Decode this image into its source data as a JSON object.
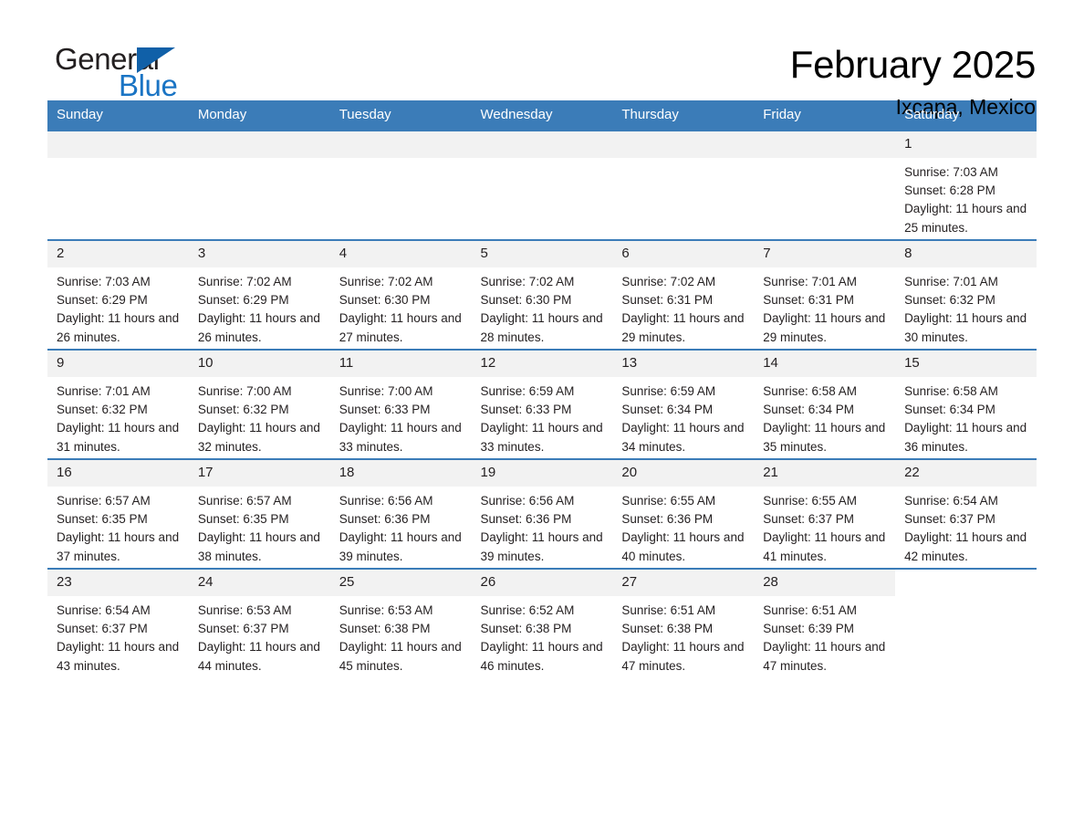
{
  "brand": {
    "name_top": "General",
    "name_bottom": "Blue",
    "accent_color": "#1a74c4",
    "triangle_color": "#1060a8"
  },
  "header": {
    "title": "February 2025",
    "subtitle": "Ixcapa, Mexico"
  },
  "calendar": {
    "header_bg": "#3b7cb8",
    "daynum_bg": "#f2f2f2",
    "weekday_headers": [
      "Sunday",
      "Monday",
      "Tuesday",
      "Wednesday",
      "Thursday",
      "Friday",
      "Saturday"
    ],
    "weeks": [
      [
        {
          "day": "",
          "empty": true
        },
        {
          "day": "",
          "empty": true
        },
        {
          "day": "",
          "empty": true
        },
        {
          "day": "",
          "empty": true
        },
        {
          "day": "",
          "empty": true
        },
        {
          "day": "",
          "empty": true
        },
        {
          "day": "1",
          "sunrise": "Sunrise: 7:03 AM",
          "sunset": "Sunset: 6:28 PM",
          "daylight": "Daylight: 11 hours and 25 minutes."
        }
      ],
      [
        {
          "day": "2",
          "sunrise": "Sunrise: 7:03 AM",
          "sunset": "Sunset: 6:29 PM",
          "daylight": "Daylight: 11 hours and 26 minutes."
        },
        {
          "day": "3",
          "sunrise": "Sunrise: 7:02 AM",
          "sunset": "Sunset: 6:29 PM",
          "daylight": "Daylight: 11 hours and 26 minutes."
        },
        {
          "day": "4",
          "sunrise": "Sunrise: 7:02 AM",
          "sunset": "Sunset: 6:30 PM",
          "daylight": "Daylight: 11 hours and 27 minutes."
        },
        {
          "day": "5",
          "sunrise": "Sunrise: 7:02 AM",
          "sunset": "Sunset: 6:30 PM",
          "daylight": "Daylight: 11 hours and 28 minutes."
        },
        {
          "day": "6",
          "sunrise": "Sunrise: 7:02 AM",
          "sunset": "Sunset: 6:31 PM",
          "daylight": "Daylight: 11 hours and 29 minutes."
        },
        {
          "day": "7",
          "sunrise": "Sunrise: 7:01 AM",
          "sunset": "Sunset: 6:31 PM",
          "daylight": "Daylight: 11 hours and 29 minutes."
        },
        {
          "day": "8",
          "sunrise": "Sunrise: 7:01 AM",
          "sunset": "Sunset: 6:32 PM",
          "daylight": "Daylight: 11 hours and 30 minutes."
        }
      ],
      [
        {
          "day": "9",
          "sunrise": "Sunrise: 7:01 AM",
          "sunset": "Sunset: 6:32 PM",
          "daylight": "Daylight: 11 hours and 31 minutes."
        },
        {
          "day": "10",
          "sunrise": "Sunrise: 7:00 AM",
          "sunset": "Sunset: 6:32 PM",
          "daylight": "Daylight: 11 hours and 32 minutes."
        },
        {
          "day": "11",
          "sunrise": "Sunrise: 7:00 AM",
          "sunset": "Sunset: 6:33 PM",
          "daylight": "Daylight: 11 hours and 33 minutes."
        },
        {
          "day": "12",
          "sunrise": "Sunrise: 6:59 AM",
          "sunset": "Sunset: 6:33 PM",
          "daylight": "Daylight: 11 hours and 33 minutes."
        },
        {
          "day": "13",
          "sunrise": "Sunrise: 6:59 AM",
          "sunset": "Sunset: 6:34 PM",
          "daylight": "Daylight: 11 hours and 34 minutes."
        },
        {
          "day": "14",
          "sunrise": "Sunrise: 6:58 AM",
          "sunset": "Sunset: 6:34 PM",
          "daylight": "Daylight: 11 hours and 35 minutes."
        },
        {
          "day": "15",
          "sunrise": "Sunrise: 6:58 AM",
          "sunset": "Sunset: 6:34 PM",
          "daylight": "Daylight: 11 hours and 36 minutes."
        }
      ],
      [
        {
          "day": "16",
          "sunrise": "Sunrise: 6:57 AM",
          "sunset": "Sunset: 6:35 PM",
          "daylight": "Daylight: 11 hours and 37 minutes."
        },
        {
          "day": "17",
          "sunrise": "Sunrise: 6:57 AM",
          "sunset": "Sunset: 6:35 PM",
          "daylight": "Daylight: 11 hours and 38 minutes."
        },
        {
          "day": "18",
          "sunrise": "Sunrise: 6:56 AM",
          "sunset": "Sunset: 6:36 PM",
          "daylight": "Daylight: 11 hours and 39 minutes."
        },
        {
          "day": "19",
          "sunrise": "Sunrise: 6:56 AM",
          "sunset": "Sunset: 6:36 PM",
          "daylight": "Daylight: 11 hours and 39 minutes."
        },
        {
          "day": "20",
          "sunrise": "Sunrise: 6:55 AM",
          "sunset": "Sunset: 6:36 PM",
          "daylight": "Daylight: 11 hours and 40 minutes."
        },
        {
          "day": "21",
          "sunrise": "Sunrise: 6:55 AM",
          "sunset": "Sunset: 6:37 PM",
          "daylight": "Daylight: 11 hours and 41 minutes."
        },
        {
          "day": "22",
          "sunrise": "Sunrise: 6:54 AM",
          "sunset": "Sunset: 6:37 PM",
          "daylight": "Daylight: 11 hours and 42 minutes."
        }
      ],
      [
        {
          "day": "23",
          "sunrise": "Sunrise: 6:54 AM",
          "sunset": "Sunset: 6:37 PM",
          "daylight": "Daylight: 11 hours and 43 minutes."
        },
        {
          "day": "24",
          "sunrise": "Sunrise: 6:53 AM",
          "sunset": "Sunset: 6:37 PM",
          "daylight": "Daylight: 11 hours and 44 minutes."
        },
        {
          "day": "25",
          "sunrise": "Sunrise: 6:53 AM",
          "sunset": "Sunset: 6:38 PM",
          "daylight": "Daylight: 11 hours and 45 minutes."
        },
        {
          "day": "26",
          "sunrise": "Sunrise: 6:52 AM",
          "sunset": "Sunset: 6:38 PM",
          "daylight": "Daylight: 11 hours and 46 minutes."
        },
        {
          "day": "27",
          "sunrise": "Sunrise: 6:51 AM",
          "sunset": "Sunset: 6:38 PM",
          "daylight": "Daylight: 11 hours and 47 minutes."
        },
        {
          "day": "28",
          "sunrise": "Sunrise: 6:51 AM",
          "sunset": "Sunset: 6:39 PM",
          "daylight": "Daylight: 11 hours and 47 minutes."
        },
        {
          "day": "",
          "empty": true,
          "blank_tail": true
        }
      ]
    ]
  }
}
